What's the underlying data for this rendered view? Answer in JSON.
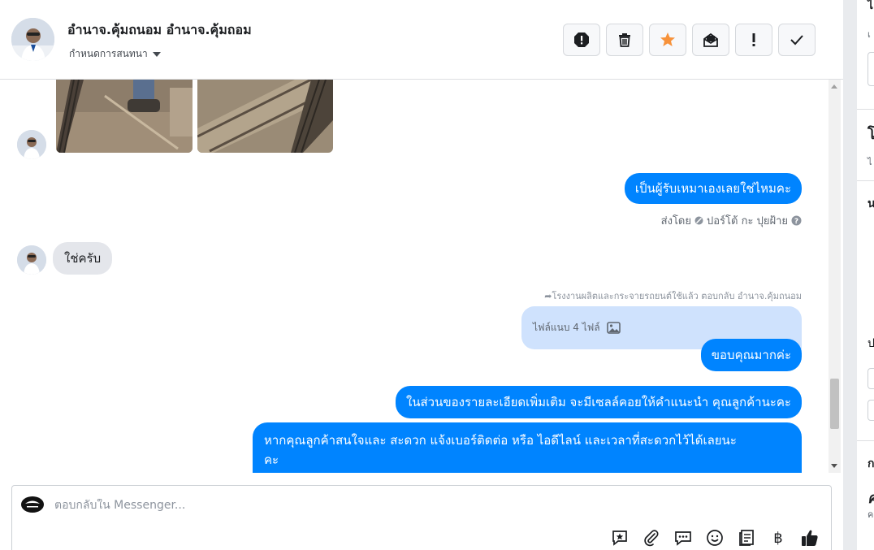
{
  "header": {
    "title": "อำนาจ.คุ้มถนอม อำนาจ.คุ้มถอม",
    "subtitle": "กำหนดการสนทนา"
  },
  "toolbar": {
    "icons": [
      "report-icon",
      "trash-icon",
      "star-icon",
      "mark-unread-icon",
      "important-icon",
      "done-check-icon"
    ],
    "colors": {
      "star": "#f7923a"
    }
  },
  "messages": {
    "out1": "เป็นผู้รับเหมาเองเลยใช่ไหมคะ",
    "sent_by_prefix": "ส่งโดย",
    "sent_by_name": "ปอร์โต้ กะ ปุยฝ้าย",
    "in1": "ใช่ครับ",
    "reply_meta": "โรงงานผลิตและกระจายรถยนต์ใช้แล้ว ตอบกลับ อำนาจ.คุ้มถนอม",
    "attachment": "ไฟล์แนบ 4 ไฟล์",
    "out2": "ขอบคุณมากค่ะ",
    "out3": "ในส่วนของรายละเอียดเพิ่มเติม จะมีเซลล์คอยให้คำแนะนำ คุณลูกค้านะคะ",
    "out4_line1": "หากคุณลูกค้าสนใจและ สะดวก แจ้งเบอร์ติดต่อ หรือ ไอดีไลน์ และเวลาที่สะดวกไว้ได้เลยนะ",
    "out4_line2": "คะ"
  },
  "composer": {
    "placeholder": "ตอบกลับใน Messenger...",
    "tools": [
      "saved-reply-icon",
      "paperclip-icon",
      "chat-bubbles-icon",
      "emoji-icon",
      "notes-icon",
      "baht-icon",
      "thumbs-up-icon"
    ],
    "baht_symbol": "฿"
  },
  "side_panel": {
    "labels": [
      "ไ",
      "เ",
      "โ",
      "ไ",
      "น",
      "ป",
      "ก",
      "ค"
    ]
  },
  "colors": {
    "accent": "#0084ff",
    "incoming": "#e4e6eb",
    "attachment_bg": "#cfe2fd"
  }
}
